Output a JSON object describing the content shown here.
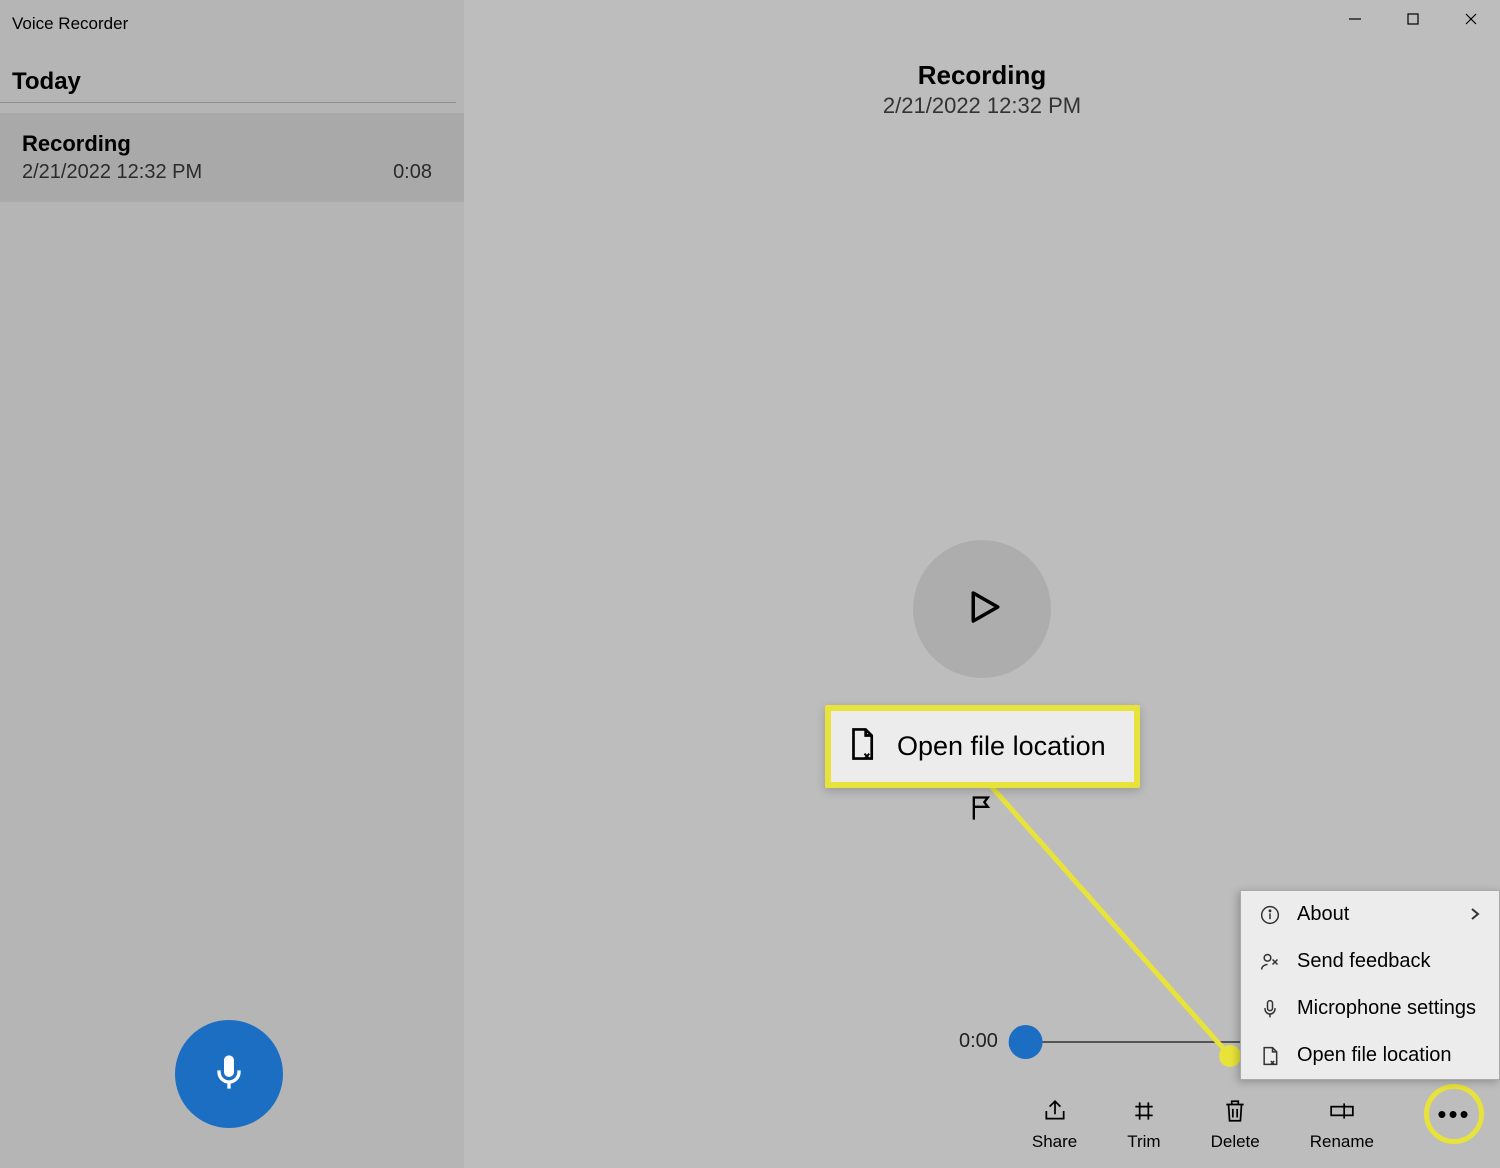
{
  "app": {
    "title": "Voice Recorder"
  },
  "sidebar": {
    "section": "Today",
    "items": [
      {
        "title": "Recording",
        "date": "2/21/2022 12:32 PM",
        "duration": "0:08"
      }
    ]
  },
  "header": {
    "title": "Recording",
    "subtitle": "2/21/2022 12:32 PM"
  },
  "timeline": {
    "current": "0:00"
  },
  "callout": {
    "label": "Open file location"
  },
  "toolbar": {
    "share": "Share",
    "trim": "Trim",
    "delete": "Delete",
    "rename": "Rename"
  },
  "menu": {
    "about": "About",
    "feedback": "Send feedback",
    "mic": "Microphone settings",
    "open": "Open file location"
  }
}
